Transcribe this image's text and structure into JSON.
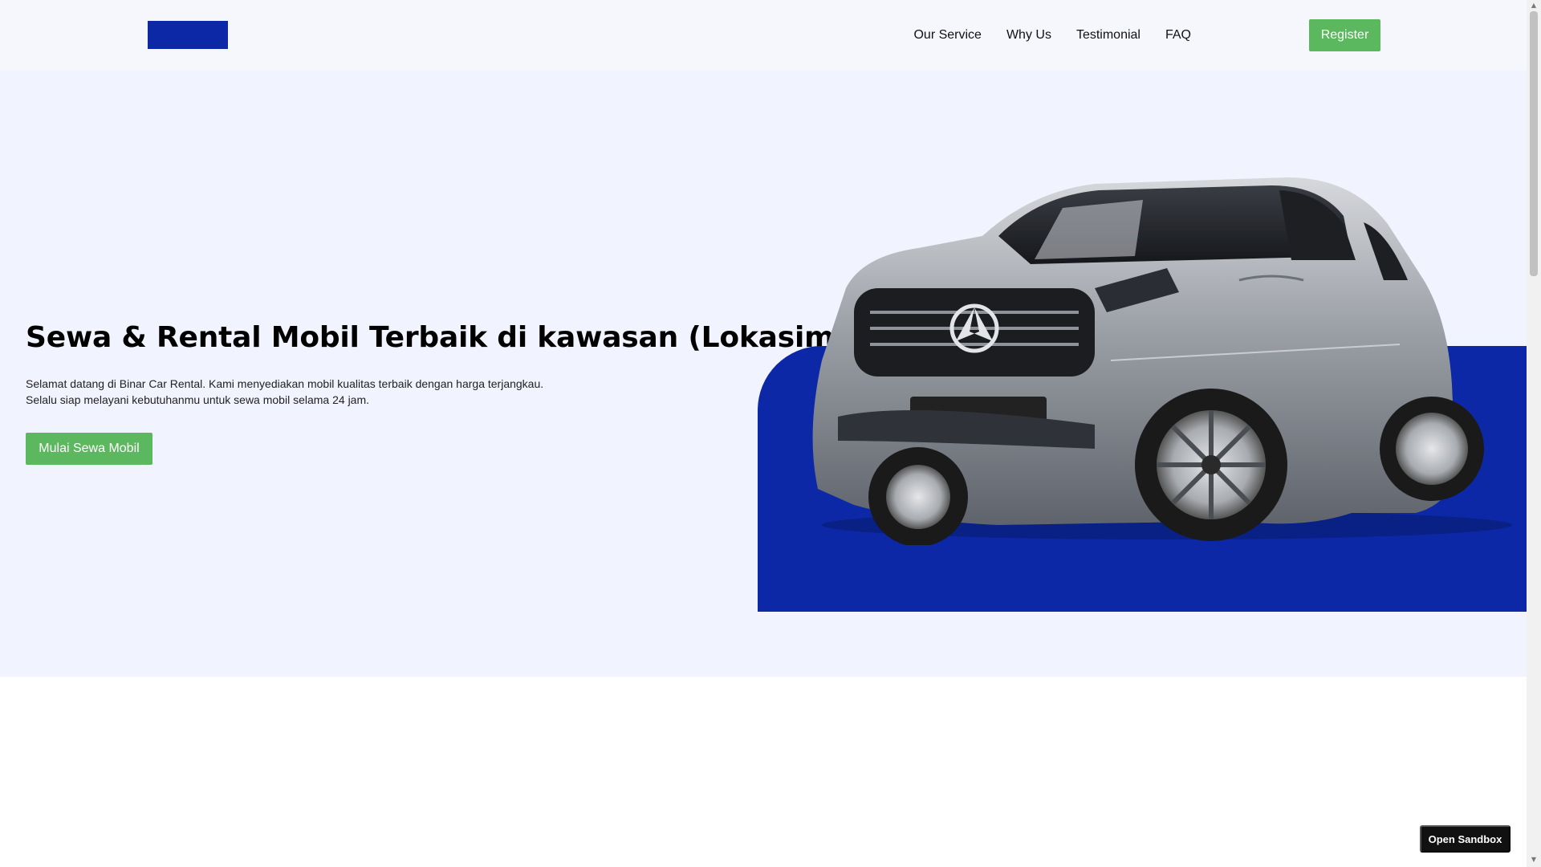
{
  "nav": {
    "links": [
      "Our Service",
      "Why Us",
      "Testimonial",
      "FAQ"
    ],
    "register_label": "Register"
  },
  "hero": {
    "title": "Sewa & Rental Mobil Terbaik di kawasan (Lokasimu)",
    "description_line1": "Selamat datang di Binar Car Rental. Kami menyediakan mobil kualitas terbaik dengan harga terjangkau.",
    "description_line2": "Selalu siap melayani kebutuhanmu untuk sewa mobil selama 24 jam.",
    "cta_label": "Mulai Sewa Mobil"
  },
  "sandbox": {
    "label": "Open Sandbox"
  },
  "colors": {
    "brand_blue": "#0d28a6",
    "accent_green": "#5cb85f",
    "hero_background": "#f1f3fe"
  },
  "icons": [
    "car-image",
    "scroll-up-arrow-icon",
    "scroll-down-arrow-icon"
  ]
}
